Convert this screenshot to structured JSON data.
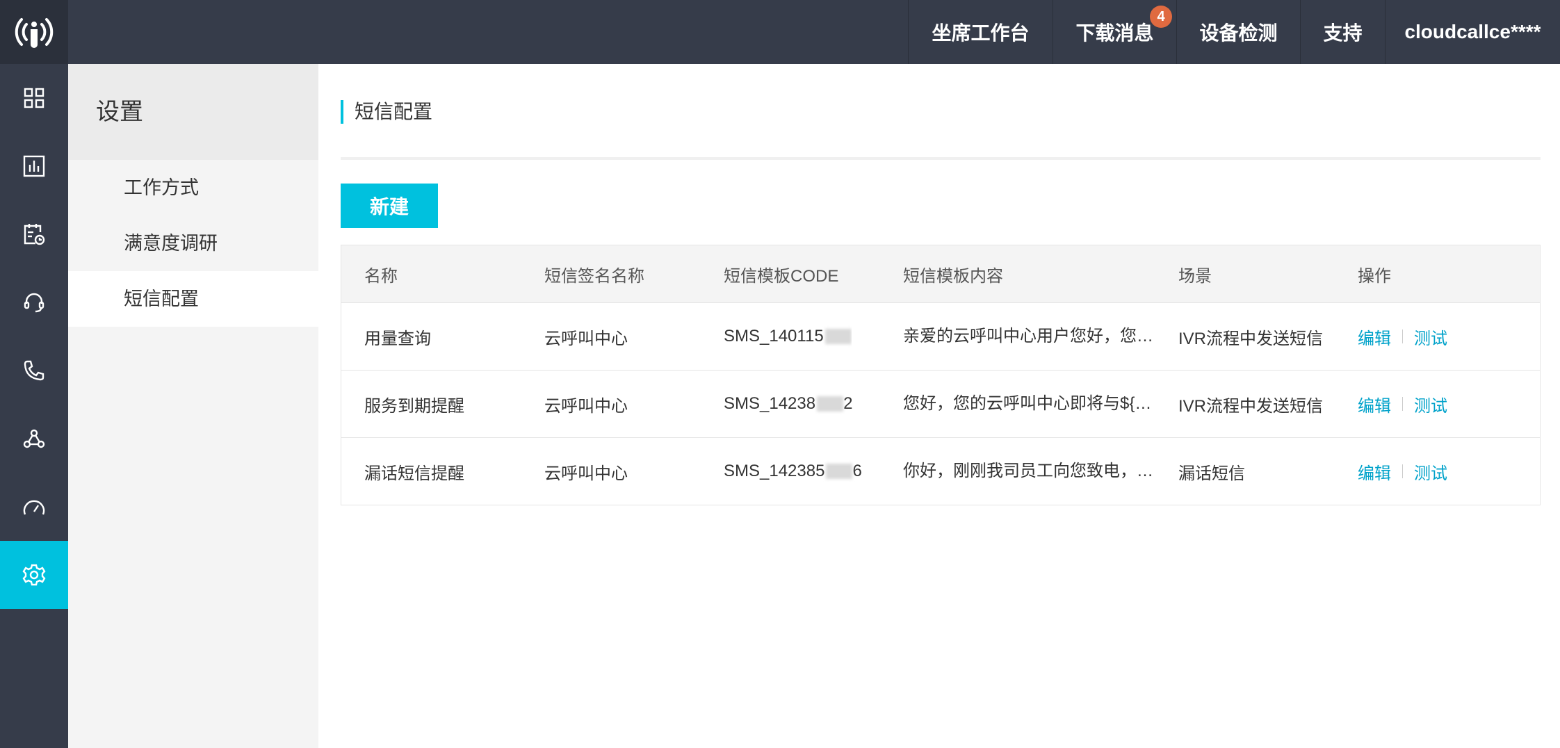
{
  "topbar": {
    "nav": [
      "坐席工作台",
      "下载消息",
      "设备检测",
      "支持",
      "cloudcallce****"
    ],
    "badge": "4"
  },
  "rail": {
    "icons": [
      "grid-icon",
      "bar-chart-icon",
      "calendar-clock-icon",
      "headset-icon",
      "phone-icon",
      "network-icon",
      "gauge-icon",
      "gear-icon"
    ],
    "active_index": 7
  },
  "sidebar": {
    "title": "设置",
    "items": [
      "工作方式",
      "满意度调研",
      "短信配置"
    ],
    "active_index": 2
  },
  "main": {
    "title": "短信配置",
    "new_button": "新建",
    "columns": [
      "名称",
      "短信签名名称",
      "短信模板CODE",
      "短信模板内容",
      "场景",
      "操作"
    ],
    "rows": [
      {
        "name": "用量查询",
        "sign": "云呼叫中心",
        "code": "SMS_140115",
        "content": "亲爱的云呼叫中心用户您好，您的云呼叫中心",
        "scene": "IVR流程中发送短信",
        "edit": "编辑",
        "test": "测试"
      },
      {
        "name": "服务到期提醒",
        "sign": "云呼叫中心",
        "code": "SMS_14238",
        "code_tail": "2",
        "content": "您好，您的云呼叫中心即将与${time}",
        "scene": "IVR流程中发送短信",
        "edit": "编辑",
        "test": "测试"
      },
      {
        "name": "漏话短信提醒",
        "sign": "云呼叫中心",
        "code": "SMS_142385",
        "code_tail": "6",
        "content": "你好，刚刚我司员工向您致电，您未接听",
        "scene": "漏话短信",
        "edit": "编辑",
        "test": "测试"
      }
    ]
  },
  "colors": {
    "accent": "#00c1de",
    "topbar": "#363c4a",
    "badge": "#e06a40",
    "link": "#00a2ca"
  }
}
